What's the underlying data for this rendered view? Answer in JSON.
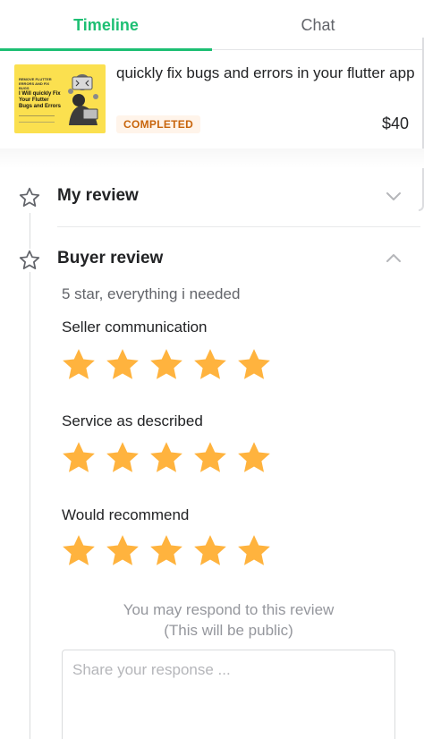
{
  "tabs": [
    {
      "label": "Timeline",
      "active": true
    },
    {
      "label": "Chat",
      "active": false
    }
  ],
  "order": {
    "thumbnail": {
      "line1": "REMOVE FLUTTER ERRORS AND FIX BUGS",
      "line2": "I Will quickly Fix Your Flutter Bugs and Errors"
    },
    "title": "quickly fix bugs and errors in your flutter app",
    "status": "COMPLETED",
    "price": "$40"
  },
  "my_review": {
    "title": "My review",
    "expanded": false
  },
  "buyer_review": {
    "title": "Buyer review",
    "expanded": true,
    "text": "5 star, everything i needed",
    "ratings": [
      {
        "label": "Seller communication",
        "stars": 5
      },
      {
        "label": "Service as described",
        "stars": 5
      },
      {
        "label": "Would recommend",
        "stars": 5
      }
    ]
  },
  "respond": {
    "line1": "You may respond to this review",
    "line2": "(This will be public)",
    "placeholder": "Share your response ..."
  },
  "colors": {
    "accent": "#1dbf73",
    "star": "#ffb33e",
    "badge_text": "#c8650c",
    "badge_bg": "#fff4ea"
  }
}
